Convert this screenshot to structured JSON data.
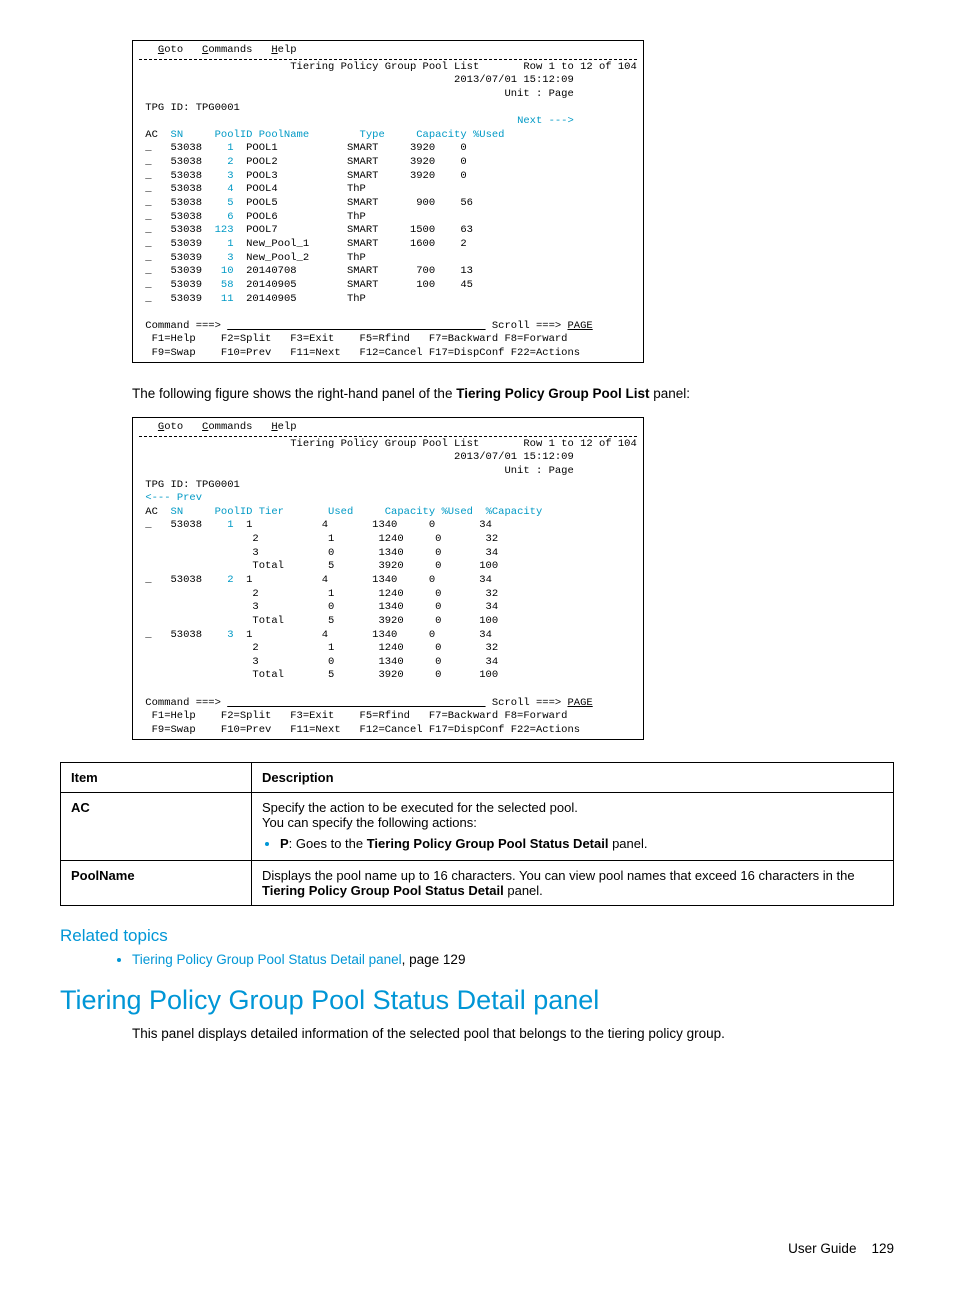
{
  "terminal1": {
    "menu": {
      "goto": "Goto",
      "commands": "Commands",
      "help": "Help"
    },
    "title": "Tiering Policy Group Pool List",
    "row_info": "Row 1 to 12 of 104",
    "datetime": "2013/07/01 15:12:09",
    "unit": "Unit : Page",
    "tpg": "TPG ID: TPG0001",
    "next": "Next --->",
    "headers": {
      "ac": "AC",
      "sn": "SN",
      "poolid": "PoolID",
      "poolname": "PoolName",
      "type": "Type",
      "capacity": "Capacity",
      "used": "%Used"
    },
    "rows": [
      {
        "sn": "53038",
        "pid": "1",
        "name": "POOL1",
        "type": "SMART",
        "cap": "3920",
        "used": "0"
      },
      {
        "sn": "53038",
        "pid": "2",
        "name": "POOL2",
        "type": "SMART",
        "cap": "3920",
        "used": "0"
      },
      {
        "sn": "53038",
        "pid": "3",
        "name": "POOL3",
        "type": "SMART",
        "cap": "3920",
        "used": "0"
      },
      {
        "sn": "53038",
        "pid": "4",
        "name": "POOL4",
        "type": "ThP",
        "cap": "",
        "used": ""
      },
      {
        "sn": "53038",
        "pid": "5",
        "name": "POOL5",
        "type": "SMART",
        "cap": "900",
        "used": "56"
      },
      {
        "sn": "53038",
        "pid": "6",
        "name": "POOL6",
        "type": "ThP",
        "cap": "",
        "used": ""
      },
      {
        "sn": "53038",
        "pid": "123",
        "name": "POOL7",
        "type": "SMART",
        "cap": "1500",
        "used": "63"
      },
      {
        "sn": "53039",
        "pid": "1",
        "name": "New_Pool_1",
        "type": "SMART",
        "cap": "1600",
        "used": "2"
      },
      {
        "sn": "53039",
        "pid": "3",
        "name": "New_Pool_2",
        "type": "ThP",
        "cap": "",
        "used": ""
      },
      {
        "sn": "53039",
        "pid": "10",
        "name": "20140708",
        "type": "SMART",
        "cap": "700",
        "used": "13"
      },
      {
        "sn": "53039",
        "pid": "58",
        "name": "20140905",
        "type": "SMART",
        "cap": "100",
        "used": "45"
      },
      {
        "sn": "53039",
        "pid": "11",
        "name": "20140905",
        "type": "ThP",
        "cap": "",
        "used": ""
      }
    ],
    "command": "Command ===>",
    "scroll": "Scroll ===> PAGE",
    "fkeys": {
      "r1": {
        "f1": "F1=Help",
        "f2": "F2=Split",
        "f3": "F3=Exit",
        "f5": "F5=Rfind",
        "f7": "F7=Backward",
        "f8": "F8=Forward"
      },
      "r2": {
        "f9": "F9=Swap",
        "f10": "F10=Prev",
        "f11": "F11=Next",
        "f12": "F12=Cancel",
        "f17": "F17=DispConf",
        "f22": "F22=Actions"
      }
    }
  },
  "intro1": {
    "before": "The following figure shows the right-hand panel of the ",
    "bold": "Tiering Policy Group Pool List",
    "after": " panel:"
  },
  "terminal2": {
    "menu": {
      "goto": "Goto",
      "commands": "Commands",
      "help": "Help"
    },
    "title": "Tiering Policy Group Pool List",
    "row_info": "Row 1 to 12 of 104",
    "datetime": "2013/07/01 15:12:09",
    "unit": "Unit : Page",
    "tpg": "TPG ID: TPG0001",
    "prev": "<--- Prev",
    "headers": {
      "ac": "AC",
      "sn": "SN",
      "poolid": "PoolID",
      "tier": "Tier",
      "used": "Used",
      "capacity": "Capacity",
      "pct_used": "%Used",
      "pct_capacity": "%Capacity"
    },
    "groups": [
      {
        "sn": "53038",
        "pid": "1",
        "tiers": [
          {
            "tier": "1",
            "used": "4",
            "cap": "1340",
            "pused": "0",
            "pcap": "34"
          },
          {
            "tier": "2",
            "used": "1",
            "cap": "1240",
            "pused": "0",
            "pcap": "32"
          },
          {
            "tier": "3",
            "used": "0",
            "cap": "1340",
            "pused": "0",
            "pcap": "34"
          },
          {
            "tier": "Total",
            "used": "5",
            "cap": "3920",
            "pused": "0",
            "pcap": "100"
          }
        ]
      },
      {
        "sn": "53038",
        "pid": "2",
        "tiers": [
          {
            "tier": "1",
            "used": "4",
            "cap": "1340",
            "pused": "0",
            "pcap": "34"
          },
          {
            "tier": "2",
            "used": "1",
            "cap": "1240",
            "pused": "0",
            "pcap": "32"
          },
          {
            "tier": "3",
            "used": "0",
            "cap": "1340",
            "pused": "0",
            "pcap": "34"
          },
          {
            "tier": "Total",
            "used": "5",
            "cap": "3920",
            "pused": "0",
            "pcap": "100"
          }
        ]
      },
      {
        "sn": "53038",
        "pid": "3",
        "tiers": [
          {
            "tier": "1",
            "used": "4",
            "cap": "1340",
            "pused": "0",
            "pcap": "34"
          },
          {
            "tier": "2",
            "used": "1",
            "cap": "1240",
            "pused": "0",
            "pcap": "32"
          },
          {
            "tier": "3",
            "used": "0",
            "cap": "1340",
            "pused": "0",
            "pcap": "34"
          },
          {
            "tier": "Total",
            "used": "5",
            "cap": "3920",
            "pused": "0",
            "pcap": "100"
          }
        ]
      }
    ],
    "command": "Command ===>",
    "scroll": "Scroll ===> PAGE",
    "fkeys": {
      "r1": {
        "f1": "F1=Help",
        "f2": "F2=Split",
        "f3": "F3=Exit",
        "f5": "F5=Rfind",
        "f7": "F7=Backward",
        "f8": "F8=Forward"
      },
      "r2": {
        "f9": "F9=Swap",
        "f10": "F10=Prev",
        "f11": "F11=Next",
        "f12": "F12=Cancel",
        "f17": "F17=DispConf",
        "f22": "F22=Actions"
      }
    }
  },
  "table": {
    "headers": {
      "item": "Item",
      "desc": "Description"
    },
    "rows": [
      {
        "item": "AC",
        "para": "Specify the action to be executed for the selected pool.\nYou can specify the following actions:",
        "bullet_bold": "P",
        "bullet_mid": ": Goes to the ",
        "bullet_bold2": "Tiering Policy Group Pool Status Detail",
        "bullet_tail": " panel."
      },
      {
        "item": "PoolName",
        "para1": "Displays the pool name up to 16 characters. You can view pool names that exceed 16 characters in the ",
        "bold": "Tiering Policy Group Pool Status Detail",
        "para2": " panel."
      }
    ]
  },
  "related": {
    "heading": "Related topics",
    "link": "Tiering Policy Group Pool Status Detail panel",
    "tail": ", page 129"
  },
  "heading": "Tiering Policy Group Pool Status Detail panel",
  "body": "This panel displays detailed information of the selected pool that belongs to the tiering policy group.",
  "footer": {
    "label": "User Guide",
    "page": "129"
  }
}
